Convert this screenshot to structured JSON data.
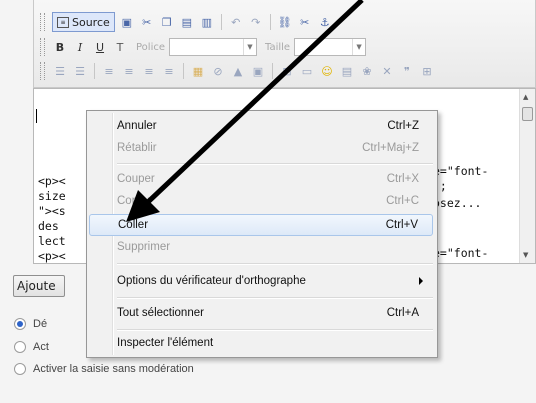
{
  "toolbar": {
    "source_label": "Source",
    "font_placeholder": "Police",
    "size_placeholder": "Taille"
  },
  "editor": {
    "code_lines": [
      "<p><",
      "size",
      "\"><s",
      "des",
      "lect",
      "<p><"
    ],
    "code_right": [
      "e=\"font-",
      ");",
      "osez...",
      "",
      "",
      "e=\"font-"
    ]
  },
  "context_menu": {
    "items": [
      {
        "label": "Annuler",
        "shortcut": "Ctrl+Z",
        "disabled": false
      },
      {
        "label": "Rétablir",
        "shortcut": "Ctrl+Maj+Z",
        "disabled": true
      },
      {
        "label": "Couper",
        "shortcut": "Ctrl+X",
        "disabled": true
      },
      {
        "label": "Copier",
        "shortcut": "Ctrl+C",
        "disabled": true
      },
      {
        "label": "Coller",
        "shortcut": "Ctrl+V",
        "disabled": false,
        "highlighted": true
      },
      {
        "label": "Supprimer",
        "shortcut": "",
        "disabled": true
      },
      {
        "label": "Options du vérificateur d'orthographe",
        "shortcut": "",
        "submenu": true
      },
      {
        "label": "Tout sélectionner",
        "shortcut": "Ctrl+A"
      },
      {
        "label": "Inspecter l'élément",
        "shortcut": ""
      }
    ]
  },
  "form": {
    "add_button": "Ajoute",
    "radio_1": "Dé",
    "radio_2": "Act",
    "radio_3": "Activer la saisie sans modération"
  },
  "colors": {
    "arrow": "#000000",
    "highlight_border": "#a9c6ea",
    "radio_selected": "#2d63c8"
  }
}
